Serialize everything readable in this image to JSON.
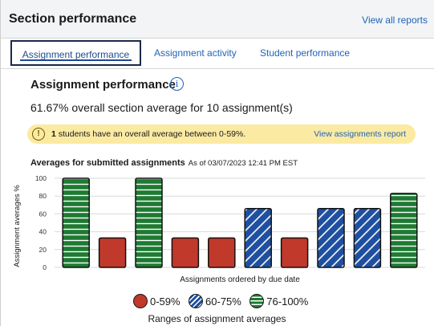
{
  "header": {
    "title": "Section performance",
    "link_label": "View all reports"
  },
  "tabs": [
    {
      "label": "Assignment performance",
      "active": true
    },
    {
      "label": "Assignment activity",
      "active": false
    },
    {
      "label": "Student performance",
      "active": false
    }
  ],
  "section": {
    "title": "Assignment performance",
    "info_icon": "i",
    "average_text": "61.67% overall section average for 10 assignment(s)"
  },
  "alert": {
    "icon": "!",
    "count": "1",
    "message": " students have an overall average between 0-59%.",
    "link_label": "View assignments report"
  },
  "chart_heading": {
    "title": "Averages for submitted assignments",
    "as_of": "As of 03/07/2023 12:41 PM EST"
  },
  "colors": {
    "red": "#c0392b",
    "blue": "#1e4fa0",
    "green": "#1e7a32",
    "link": "#1e63b8"
  },
  "chart_data": {
    "type": "bar",
    "title": "Averages for submitted assignments",
    "xlabel": "Assignments ordered by due date",
    "ylabel": "Assignment averages %",
    "ylim": [
      0,
      100
    ],
    "yticks": [
      0,
      20,
      40,
      60,
      80,
      100
    ],
    "grid": true,
    "values": [
      100,
      33,
      100,
      33,
      33,
      66,
      33,
      66,
      66,
      83
    ],
    "bands": [
      {
        "label": "0-59%",
        "min": 0,
        "max": 59,
        "color": "#c0392b",
        "pattern": "solid"
      },
      {
        "label": "60-75%",
        "min": 60,
        "max": 75,
        "color": "#1e4fa0",
        "pattern": "diagonal"
      },
      {
        "label": "76-100%",
        "min": 76,
        "max": 100,
        "color": "#1e7a32",
        "pattern": "horizontal"
      }
    ],
    "legend_caption": "Ranges of assignment averages"
  }
}
